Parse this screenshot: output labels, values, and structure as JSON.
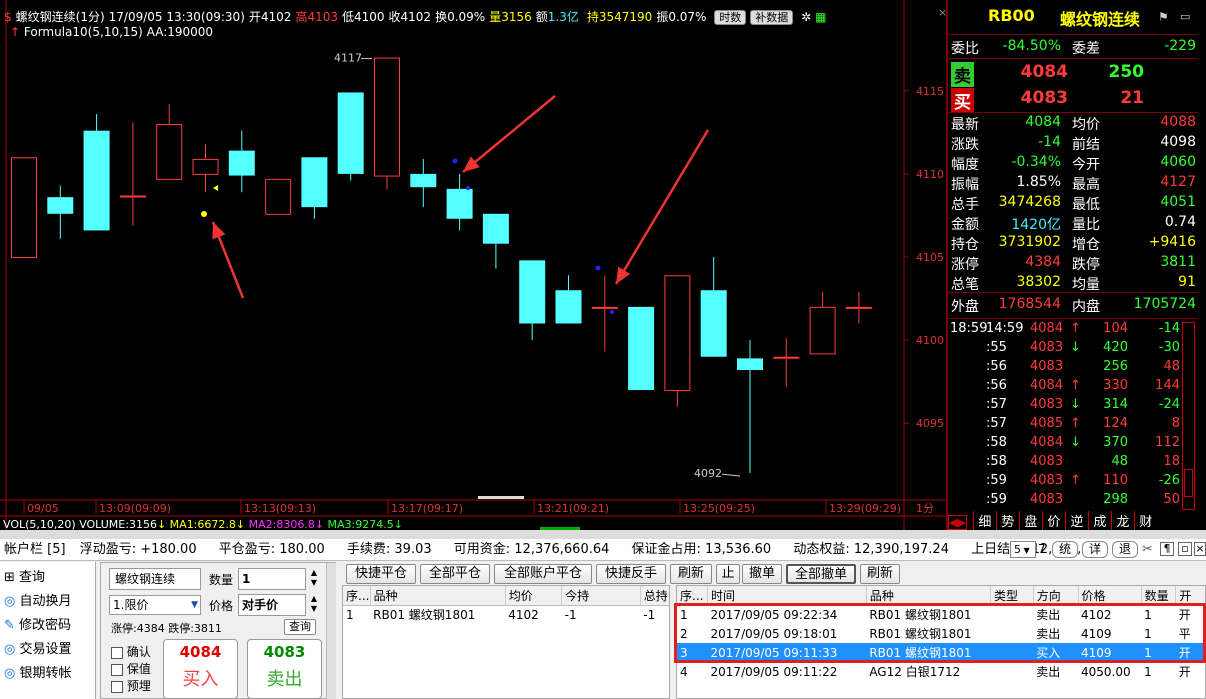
{
  "chart_header": {
    "symbol_period": "螺纹钢连续(1分)",
    "datetime": "17/09/05 13:30(09:30)",
    "open": "开4102",
    "high": "高4103",
    "low": "低4100",
    "close": "收4102",
    "turnover_rate": "换0.09%",
    "volume": "量3156",
    "amount_label": "额",
    "amount": "1.3亿",
    "open_interest": "持3547190",
    "amplitude": "振0.07%",
    "btn_timeshare": "时数",
    "btn_fill": "补数据",
    "formula": "Formula10(5,10,15)  AA:190000"
  },
  "chart_data": {
    "type": "candlestick",
    "title": "螺纹钢连续(1分)",
    "series": [
      {
        "name": "1分K线",
        "values": [
          {
            "o": 4105,
            "c": 4111,
            "h": 4111,
            "l": 4109.4
          },
          {
            "o": 4108.6,
            "c": 4107.6,
            "h": 4109.3,
            "l": 4106.1
          },
          {
            "o": 4112.6,
            "c": 4106.6,
            "h": 4113.6,
            "l": 4106.6
          },
          {
            "o": 4108.7,
            "c": 4108.7,
            "h": 4113.1,
            "l": 4106.9
          },
          {
            "o": 4109.7,
            "c": 4113.0,
            "h": 4114.2,
            "l": 4109.7
          },
          {
            "o": 4110.0,
            "c": 4110.9,
            "h": 4111.8,
            "l": 4108.9
          },
          {
            "o": 4111.4,
            "c": 4109.9,
            "h": 4112.6,
            "l": 4108.9
          },
          {
            "o": 4107.6,
            "c": 4109.7,
            "h": 4109.7,
            "l": 4107.6
          },
          {
            "o": 4111.0,
            "c": 4108.0,
            "h": 4111.0,
            "l": 4107.3
          },
          {
            "o": 4114.9,
            "c": 4110.0,
            "h": 4114.9,
            "l": 4109.6
          },
          {
            "o": 4109.9,
            "c": 4117.0,
            "h": 4117.0,
            "l": 4109.1
          },
          {
            "o": 4110.0,
            "c": 4109.2,
            "h": 4110.9,
            "l": 4108.0
          },
          {
            "o": 4109.1,
            "c": 4107.3,
            "h": 4110.0,
            "l": 4106.6
          },
          {
            "o": 4107.6,
            "c": 4105.8,
            "h": 4107.6,
            "l": 4104.3
          },
          {
            "o": 4104.8,
            "c": 4101.0,
            "h": 4104.8,
            "l": 4100.0
          },
          {
            "o": 4103.0,
            "c": 4101.0,
            "h": 4103.9,
            "l": 4101.0
          },
          {
            "o": 4102.0,
            "c": 4102.0,
            "h": 4103.9,
            "l": 4099.3
          },
          {
            "o": 4102.0,
            "c": 4097.0,
            "h": 4102.0,
            "l": 4097.0
          },
          {
            "o": 4097.0,
            "c": 4103.9,
            "h": 4103.9,
            "l": 4096.0
          },
          {
            "o": 4103.0,
            "c": 4099.0,
            "h": 4105.0,
            "l": 4099.0
          },
          {
            "o": 4098.9,
            "c": 4098.2,
            "h": 4100.0,
            "l": 4092.0
          },
          {
            "o": 4099.0,
            "c": 4099.0,
            "h": 4100.1,
            "l": 4097.2
          },
          {
            "o": 4099.2,
            "c": 4102.0,
            "h": 4102.9,
            "l": 4099.2
          },
          {
            "o": 4102.0,
            "c": 4102.0,
            "h": 4102.9,
            "l": 4101.0
          }
        ]
      }
    ],
    "y_ticks": [
      "4115",
      "4110",
      "4105",
      "4100",
      "4095"
    ],
    "x_ticks": [
      "09/05",
      "13:09(09:09)",
      "13:13(09:13)",
      "13:17(09:17)",
      "13:21(09:21)",
      "13:25(09:25)",
      "13:29(09:29)"
    ],
    "x_unit": "1分",
    "annotations": [
      "4117",
      "4092"
    ],
    "ylim": [
      4090.5,
      4119.5
    ],
    "indicator_line": {
      "vol": "VOL(5,10,20)",
      "volume": "VOLUME:3156",
      "ma1": "MA1:6672.8",
      "ma2": "MA2:8306.8",
      "ma3": "MA3:9274.5"
    },
    "colors": {
      "up": "#ff3b3b",
      "down": "#54ffff"
    }
  },
  "quote": {
    "code": "RB00",
    "name": "螺纹钢连续",
    "weibi_label": "委比",
    "weibi": "-84.50%",
    "weicha_label": "委差",
    "weicha": "-229",
    "sell_label": "卖",
    "sell_price": "4084",
    "sell_vol": "250",
    "buy_label": "买",
    "buy_price": "4083",
    "buy_vol": "21",
    "rows": [
      {
        "l1": "最新",
        "v1": "4084",
        "l2": "均价",
        "v2": "4088"
      },
      {
        "l1": "涨跌",
        "v1": "-14",
        "l2": "前结",
        "v2": "4098"
      },
      {
        "l1": "幅度",
        "v1": "-0.34%",
        "l2": "今开",
        "v2": "4060"
      },
      {
        "l1": "振幅",
        "v1": "1.85%",
        "l2": "最高",
        "v2": "4127"
      },
      {
        "l1": "总手",
        "v1": "3474268",
        "l2": "最低",
        "v2": "4051"
      },
      {
        "l1": "金额",
        "v1": "1420亿",
        "l2": "量比",
        "v2": "0.74"
      },
      {
        "l1": "持仓",
        "v1": "3731902",
        "l2": "增仓",
        "v2": "+9416"
      },
      {
        "l1": "涨停",
        "v1": "4384",
        "l2": "跌停",
        "v2": "3811"
      },
      {
        "l1": "总笔",
        "v1": "38302",
        "l2": "均量",
        "v2": "91"
      }
    ],
    "waipan_label": "外盘",
    "waipan": "1768544",
    "neipan_label": "内盘",
    "neipan": "1705724",
    "ticks": [
      {
        "t1": "18:59",
        "t2": "14:59",
        "p": "4084",
        "d": "↑",
        "v": "104",
        "c": "-14"
      },
      {
        "t1": "",
        "t2": ":55",
        "p": "4083",
        "d": "↓",
        "v": "420",
        "c": "-30"
      },
      {
        "t1": "",
        "t2": ":56",
        "p": "4083",
        "d": "",
        "v": "256",
        "c": "48"
      },
      {
        "t1": "",
        "t2": ":56",
        "p": "4084",
        "d": "↑",
        "v": "330",
        "c": "144"
      },
      {
        "t1": "",
        "t2": ":57",
        "p": "4083",
        "d": "↓",
        "v": "314",
        "c": "-24"
      },
      {
        "t1": "",
        "t2": ":57",
        "p": "4085",
        "d": "↑",
        "v": "124",
        "c": "8"
      },
      {
        "t1": "",
        "t2": ":58",
        "p": "4084",
        "d": "↓",
        "v": "370",
        "c": "112"
      },
      {
        "t1": "",
        "t2": ":58",
        "p": "4083",
        "d": "",
        "v": "48",
        "c": "18"
      },
      {
        "t1": "",
        "t2": ":59",
        "p": "4083",
        "d": "↑",
        "v": "110",
        "c": "-26"
      },
      {
        "t1": "",
        "t2": ":59",
        "p": "4083",
        "d": "",
        "v": "298",
        "c": "50"
      }
    ],
    "tabs": [
      "细",
      "势",
      "盘",
      "价",
      "逆",
      "成",
      "龙",
      "财"
    ]
  },
  "account_bar": {
    "title": "帐户栏 [5]",
    "float_pl": "浮动盈亏: +180.00",
    "close_pl": "平仓盈亏: 180.00",
    "fee": "手续费: 39.03",
    "available": "可用资金: 12,376,660.64",
    "margin": "保证金占用: 13,536.60",
    "equity": "动态权益: 12,390,197.24",
    "prev_settle": "上日结算: 12,389,8",
    "spin_value": "5",
    "btn_stat": "统",
    "btn_detail": "详",
    "btn_back": "退"
  },
  "left_menu": [
    "查询",
    "自动换月",
    "修改密码",
    "交易设置",
    "银期转帐"
  ],
  "order_form": {
    "contract": "螺纹钢连续",
    "qty_label": "数量",
    "qty": "1",
    "order_type": "1.限价",
    "price_label": "价格",
    "price": "对手价",
    "limit_info": "涨停:4384 跌停:3811",
    "query_btn": "查询",
    "chk_confirm": "确认",
    "chk_hold": "保值",
    "chk_pre": "预埋",
    "buy_price": "4084",
    "buy_label": "买入",
    "sell_price": "4083",
    "sell_label": "卖出"
  },
  "actions": [
    "快捷平仓",
    "全部平仓",
    "全部账户平仓",
    "快捷反手",
    "刷新",
    "止",
    "撤单",
    "全部撤单",
    "刷新"
  ],
  "positions": {
    "headers": [
      "序...",
      "品种",
      "均价",
      "今持",
      "总持"
    ],
    "rows": [
      [
        "1",
        "RB01 螺纹钢1801",
        "4102",
        "-1",
        "-1"
      ]
    ]
  },
  "orders": {
    "headers": [
      "序...",
      "时间",
      "品种",
      "类型",
      "方向",
      "价格",
      "数量",
      "开"
    ],
    "rows": [
      [
        "1",
        "2017/09/05 09:22:34",
        "RB01 螺纹钢1801",
        "",
        "卖出",
        "4102",
        "1",
        "开"
      ],
      [
        "2",
        "2017/09/05 09:18:01",
        "RB01 螺纹钢1801",
        "",
        "卖出",
        "4109",
        "1",
        "平"
      ],
      [
        "3",
        "2017/09/05 09:11:33",
        "RB01 螺纹钢1801",
        "",
        "买入",
        "4109",
        "1",
        "开"
      ],
      [
        "4",
        "2017/09/05 09:11:22",
        "AG12 白银1712",
        "",
        "卖出",
        "4050.00",
        "1",
        "开"
      ]
    ]
  }
}
